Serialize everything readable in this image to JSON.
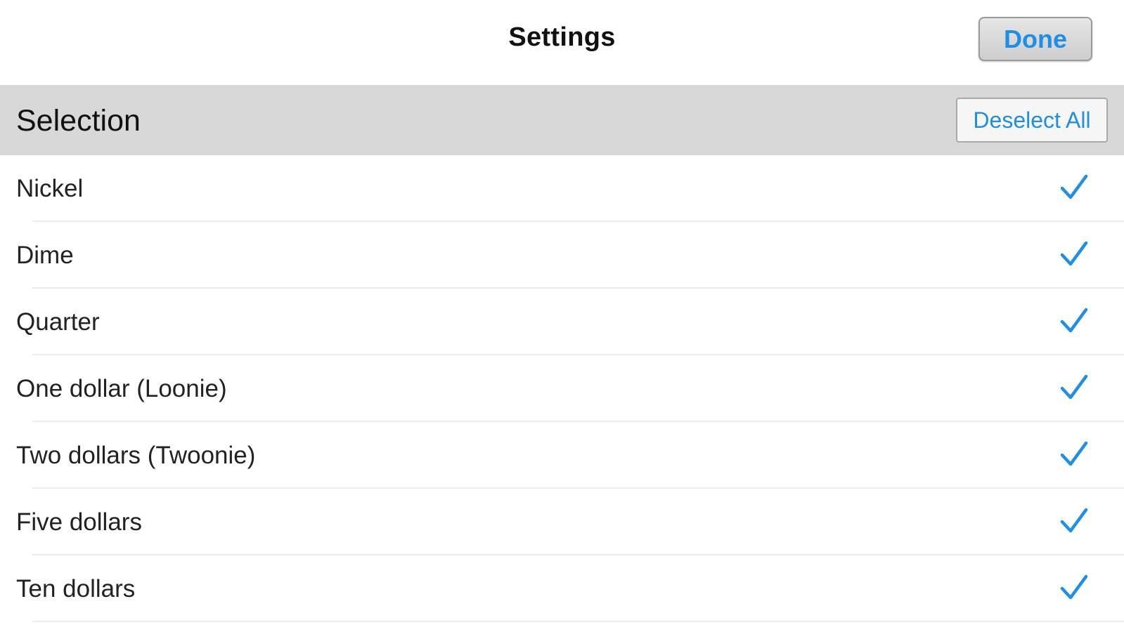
{
  "nav": {
    "title": "Settings",
    "done_label": "Done"
  },
  "section": {
    "title": "Selection",
    "deselect_label": "Deselect All"
  },
  "items": [
    {
      "label": "Nickel",
      "selected": true,
      "icon": "checkmark-icon"
    },
    {
      "label": "Dime",
      "selected": true,
      "icon": "checkmark-icon"
    },
    {
      "label": "Quarter",
      "selected": true,
      "icon": "checkmark-icon"
    },
    {
      "label": "One dollar (Loonie)",
      "selected": true,
      "icon": "checkmark-icon"
    },
    {
      "label": "Two dollars (Twoonie)",
      "selected": true,
      "icon": "checkmark-icon"
    },
    {
      "label": "Five dollars",
      "selected": true,
      "icon": "checkmark-icon"
    },
    {
      "label": "Ten dollars",
      "selected": true,
      "icon": "checkmark-icon"
    }
  ],
  "colors": {
    "accent": "#1e8ee6",
    "section_background": "#d8d8d8",
    "background": "#ffffff"
  }
}
